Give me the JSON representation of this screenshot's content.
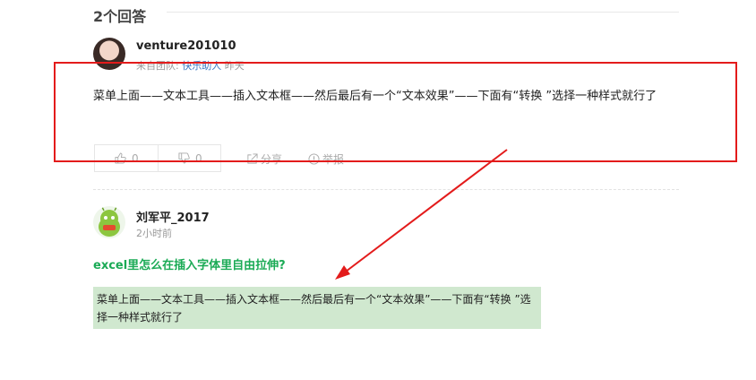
{
  "answers_header": {
    "title": "2个回答"
  },
  "answer1": {
    "username": "venture201010",
    "from_prefix": "来自团队:",
    "team": "快乐助人",
    "time": "昨天",
    "text": "菜单上面——文本工具——插入文本框——然后最后有一个“文本效果”——下面有“转换 ”选择一种样式就行了",
    "upvotes": "0",
    "downvotes": "0",
    "share_label": "分享",
    "report_label": "举报"
  },
  "answer2": {
    "username": "刘军平_2017",
    "time": "2小时前",
    "question_title": "excel里怎么在插入字体里自由拉伸?",
    "quote_text": "菜单上面——文本工具——插入文本框——然后最后有一个“文本效果”——下面有“转换 ”选择一种样式就行了"
  },
  "colors": {
    "annotation_red": "#e31b1b",
    "link_green": "#1aaa55",
    "team_blue": "#3a78c3",
    "quote_bg": "#d0e8cf"
  },
  "icons": [
    "thumbs-up-icon",
    "thumbs-down-icon",
    "share-icon",
    "report-icon"
  ]
}
